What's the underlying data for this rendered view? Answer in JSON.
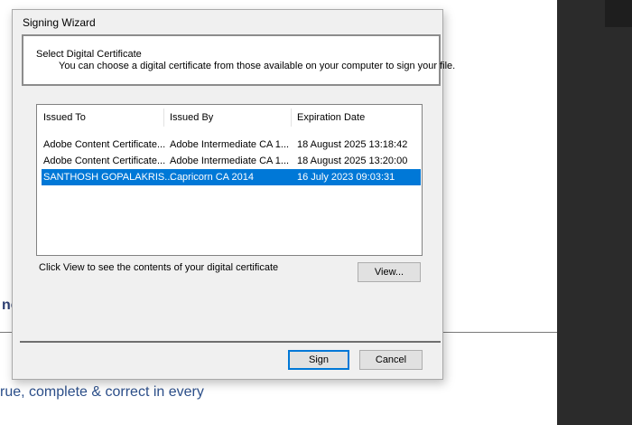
{
  "background": {
    "fragment_heading": "ne",
    "fragment_text": "rue, complete & correct in every",
    "fragment_cut_text": "..........................."
  },
  "dialog": {
    "title": "Signing Wizard",
    "header_title": "Select Digital Certificate",
    "header_subtitle": "You can choose a digital certificate from those available on your computer to sign your file.",
    "columns": [
      "Issued To",
      "Issued By",
      "Expiration Date"
    ],
    "certificates": [
      {
        "issued_to": "Adobe Content Certificate...",
        "issued_by": "Adobe Intermediate CA 1...",
        "expiration": "18 August 2025 13:18:42",
        "selected": false
      },
      {
        "issued_to": "Adobe Content Certificate...",
        "issued_by": "Adobe Intermediate CA 1...",
        "expiration": "18 August 2025 13:20:00",
        "selected": false
      },
      {
        "issued_to": "SANTHOSH GOPALAKRIS...",
        "issued_by": "Capricorn CA 2014",
        "expiration": "16 July 2023 09:03:31",
        "selected": true
      }
    ],
    "hint": "Click View to see the contents of your digital certificate",
    "view_label": "View...",
    "sign_label": "Sign",
    "cancel_label": "Cancel"
  },
  "colors": {
    "selection": "#0078d7",
    "dialog_bg": "#f0f0f0",
    "dark_panel": "#2b2b2b"
  }
}
